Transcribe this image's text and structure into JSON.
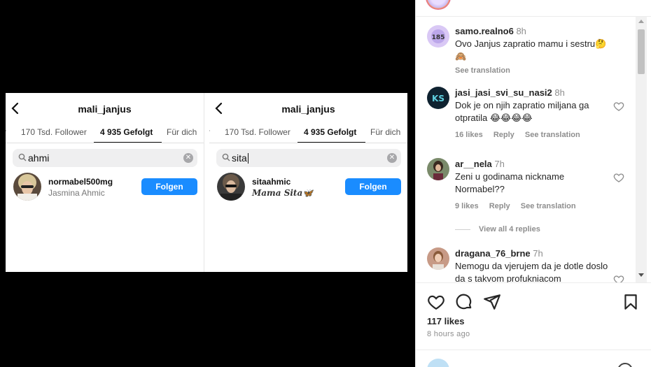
{
  "screenshot": {
    "left_panel": {
      "title": "mali_janjus",
      "tabs": [
        "r",
        "170 Tsd. Follower",
        "4 935 Gefolgt",
        "Für dich"
      ],
      "search_query": "ahmi",
      "result_username": "normabel500mg",
      "result_name": "Jasmina Ahmic",
      "follow_label": "Folgen"
    },
    "right_panel": {
      "title": "mali_janjus",
      "tabs": [
        "r",
        "170 Tsd. Follower",
        "4 935 Gefolgt",
        "Für dich"
      ],
      "search_query": "sita",
      "result_username": "sitaahmic",
      "result_name": "𝑴𝒂𝒎𝒂 𝑺𝒊𝒕𝒂🦋",
      "follow_label": "Folgen"
    }
  },
  "comments": [
    {
      "username": "samo.realno6",
      "time": "8h",
      "text": "Ovo Janjus zapratio mamu i sestru🤔🙈",
      "meta": [
        "See translation"
      ],
      "avatar_color": "#d9c8f5",
      "avatar_text": "185"
    },
    {
      "username": "jasi_jasi_svi_su_nasi2",
      "time": "8h",
      "text": "Dok je on njih zapratio miljana ga otpratila 😂😂😂😂",
      "meta": [
        "16 likes",
        "Reply",
        "See translation"
      ],
      "avatar_color": "#0f2230",
      "avatar_text": "KS"
    },
    {
      "username": "ar__nela",
      "time": "7h",
      "text": "Zeni u godinama nickname Normabel??",
      "meta": [
        "9 likes",
        "Reply",
        "See translation"
      ],
      "avatar_color": "#7a8a6a",
      "avatar_text": ""
    },
    {
      "username": "dragana_76_brne",
      "time": "7h",
      "text": "Nemogu da vjerujem da je dotle doslo da s takvom profukniacom",
      "meta": [],
      "avatar_color": "#c79a86",
      "avatar_text": ""
    }
  ],
  "view_replies": "View all 4 replies",
  "likes": "117 likes",
  "posted": "8 hours ago",
  "colors": {
    "follow_button": "#1a8cff",
    "text": "#262626",
    "muted": "#8e8e8e"
  }
}
